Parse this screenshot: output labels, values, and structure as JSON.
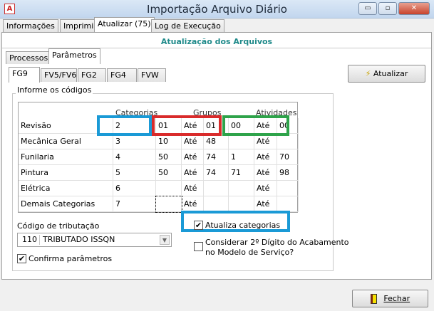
{
  "window": {
    "title": "Importação Arquivo Diário",
    "icon": "app-logo-icon"
  },
  "tabs": [
    "Informações",
    "Imprimir",
    "Atualizar (75)",
    "Log de Execução"
  ],
  "section_header": "Atualização dos Arquivos",
  "subtabs": [
    "Processos",
    "Parâmetros"
  ],
  "group_tabs": [
    "FG9",
    "FV5/FV6",
    "FG2",
    "FG4",
    "FVW"
  ],
  "groupbox_label": "Informe os códigos",
  "grid": {
    "headers": {
      "categorias": "Categorias",
      "grupos": "Grupos",
      "atividades": "Atividades"
    },
    "rows": [
      {
        "label": "Revisão",
        "cat": "2",
        "g1": "01",
        "ate1": "Até",
        "g2": "01",
        "a1": "00",
        "ate2": "Até",
        "a2": "00"
      },
      {
        "label": "Mecânica Geral",
        "cat": "3",
        "g1": "10",
        "ate1": "Até",
        "g2": "48",
        "a1": "",
        "ate2": "Até",
        "a2": ""
      },
      {
        "label": "Funilaria",
        "cat": "4",
        "g1": "50",
        "ate1": "Até",
        "g2": "74",
        "a1": "1",
        "ate2": "Até",
        "a2": "70"
      },
      {
        "label": "Pintura",
        "cat": "5",
        "g1": "50",
        "ate1": "Até",
        "g2": "74",
        "a1": "71",
        "ate2": "Até",
        "a2": "98"
      },
      {
        "label": "Elétrica",
        "cat": "6",
        "g1": "",
        "ate1": "Até",
        "g2": "",
        "a1": "",
        "ate2": "Até",
        "a2": ""
      },
      {
        "label": "Demais Categorias",
        "cat": "7",
        "g1": "",
        "ate1": "Até",
        "g2": "",
        "a1": "",
        "ate2": "Até",
        "a2": ""
      }
    ]
  },
  "highlight_colors": {
    "blue": "#1a9ad6",
    "red": "#d92b2b",
    "green": "#2ea34a"
  },
  "tributacao": {
    "label": "Código de tributação",
    "code": "110",
    "value": "TRIBUTADO ISSQN"
  },
  "confirma": {
    "label": "Confirma parâmetros",
    "checked": true
  },
  "atualiza_categorias": {
    "label": "Atualiza categorias",
    "checked": true
  },
  "considerar": {
    "line1": "Considerar 2º Dígito do Acabamento",
    "line2": "no Modelo de Serviço?",
    "checked": false
  },
  "buttons": {
    "atualizar": "Atualizar",
    "fechar": "Fechar"
  }
}
